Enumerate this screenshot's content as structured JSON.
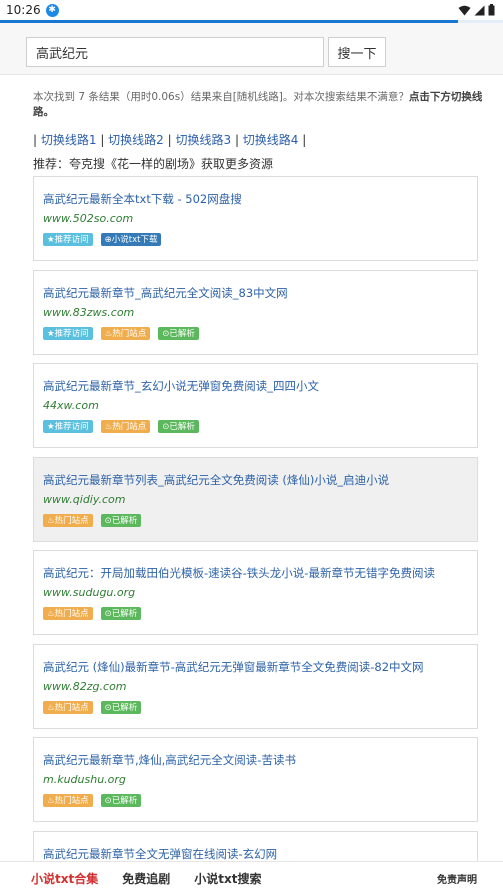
{
  "status": {
    "time": "10:26"
  },
  "progress": {
    "fraction": 0.91
  },
  "search": {
    "value": "高武纪元",
    "button": "搜一下"
  },
  "summary": {
    "text": "本次找到 7 条结果（用时0.06s）结果来自[随机线路]。对本次搜索结果不满意？",
    "emph": "点击下方切换线路。"
  },
  "lines": [
    "切换线路1",
    "切换线路2",
    "切换线路3",
    "切换线路4"
  ],
  "recommend": "推荐：夸克搜《花一样的剧场》获取更多资源",
  "results": [
    {
      "title": "高武纪元最新全本txt下载 - 502网盘搜",
      "url": "www.502so.com",
      "badges": [
        {
          "t": "★推荐访问",
          "c": "rec"
        },
        {
          "t": "⊕小说txt下载",
          "c": "dl"
        }
      ],
      "highlight": false
    },
    {
      "title": "高武纪元最新章节_高武纪元全文阅读_83中文网",
      "url": "www.83zws.com",
      "badges": [
        {
          "t": "★推荐访问",
          "c": "rec"
        },
        {
          "t": "♨热门站点",
          "c": "hot"
        },
        {
          "t": "⊙已解析",
          "c": "ok"
        }
      ],
      "highlight": false
    },
    {
      "title": "高武纪元最新章节_玄幻小说无弹窗免费阅读_四四小文",
      "url": "44xw.com",
      "badges": [
        {
          "t": "★推荐访问",
          "c": "rec"
        },
        {
          "t": "♨热门站点",
          "c": "hot"
        },
        {
          "t": "⊙已解析",
          "c": "ok"
        }
      ],
      "highlight": false
    },
    {
      "title": "高武纪元最新章节列表_高武纪元全文免费阅读 (烽仙)小说_启迪小说",
      "url": "www.qidiy.com",
      "badges": [
        {
          "t": "♨热门站点",
          "c": "hot"
        },
        {
          "t": "⊙已解析",
          "c": "ok"
        }
      ],
      "highlight": true
    },
    {
      "title": "高武纪元：开局加载田伯光模板-速读谷-铁头龙小说-最新章节无错字免费阅读",
      "url": "www.sudugu.org",
      "badges": [
        {
          "t": "♨热门站点",
          "c": "hot"
        },
        {
          "t": "⊙已解析",
          "c": "ok"
        }
      ],
      "highlight": false
    },
    {
      "title": "高武纪元 (烽仙)最新章节-高武纪元无弹窗最新章节全文免费阅读-82中文网",
      "url": "www.82zg.com",
      "badges": [
        {
          "t": "♨热门站点",
          "c": "hot"
        },
        {
          "t": "⊙已解析",
          "c": "ok"
        }
      ],
      "highlight": false
    },
    {
      "title": "高武纪元最新章节,烽仙,高武纪元全文阅读-苦读书",
      "url": "m.kudushu.org",
      "badges": [
        {
          "t": "♨热门站点",
          "c": "hot"
        },
        {
          "t": "⊙已解析",
          "c": "ok"
        }
      ],
      "highlight": false
    },
    {
      "title": "高武纪元最新章节全文无弹窗在线阅读-玄幻网",
      "url": "",
      "badges": [],
      "highlight": false
    }
  ],
  "bottom_nav": [
    "小说txt合集",
    "免费追剧",
    "小说txt搜索"
  ],
  "disclaimer": "免责声明",
  "colors": {
    "accent": "#1976d2",
    "title": "#2d62a8",
    "url": "#2e7d32",
    "active_nav": "#d32f2f"
  }
}
